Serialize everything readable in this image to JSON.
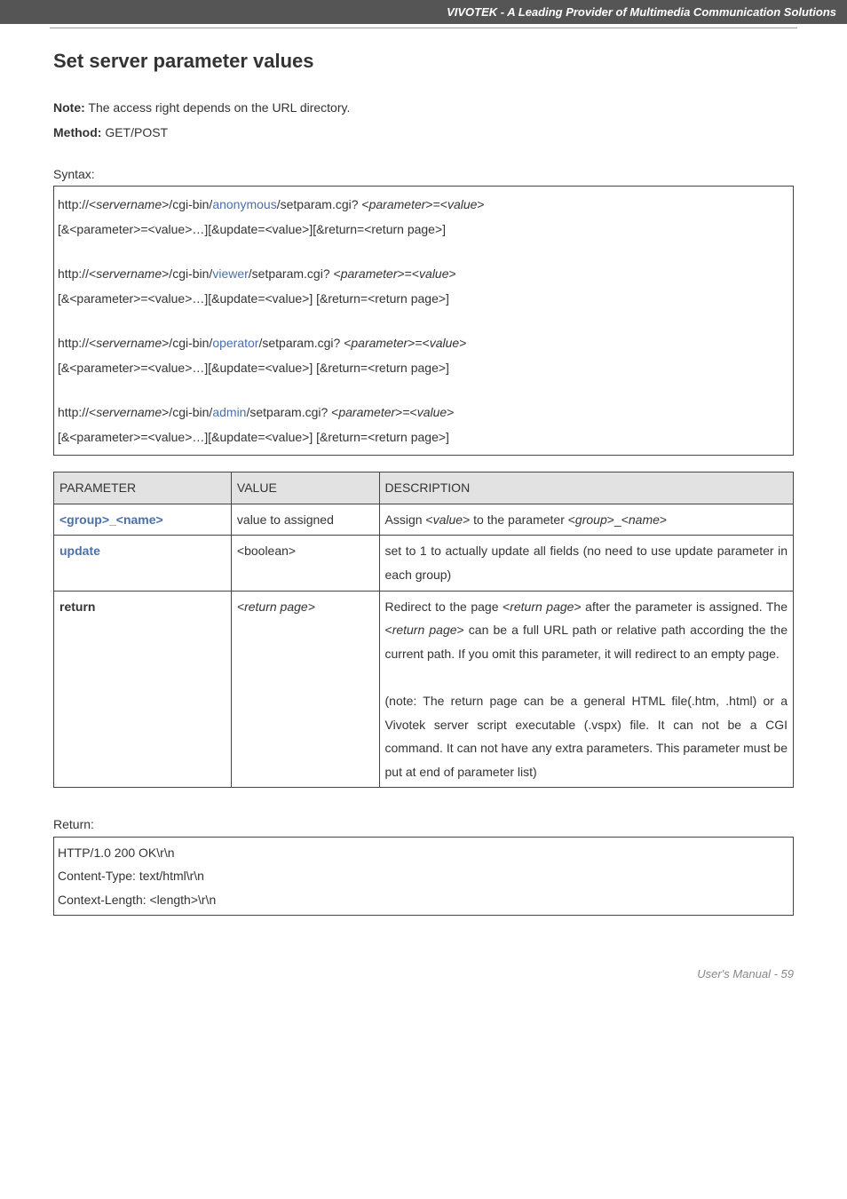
{
  "header": {
    "banner": "VIVOTEK - A Leading Provider of Multimedia Communication Solutions"
  },
  "title": "Set server parameter values",
  "intro": {
    "note_label": "Note:",
    "note_text": " The access right depends on the URL directory.",
    "method_label": "Method:",
    "method_text": " GET/POST"
  },
  "syntax_label": "Syntax:",
  "syntax": {
    "blocks": [
      {
        "pre": "http://<",
        "srv": "servername",
        "mid": ">/cgi-bin/",
        "role": "anonymous",
        "post": "/setparam.cgi? <",
        "param": "parameter",
        "eq": ">=<",
        "val": "value",
        "end": ">",
        "line2": "[&<parameter>=<value>…][&update=<value>][&return=<return page>]"
      },
      {
        "pre": "http://<",
        "srv": "servername",
        "mid": ">/cgi-bin/",
        "role": "viewer",
        "post": "/setparam.cgi? <",
        "param": "parameter",
        "eq": ">=<",
        "val": "value",
        "end": ">",
        "line2": "[&<parameter>=<value>…][&update=<value>] [&return=<return page>]"
      },
      {
        "pre": "http://<",
        "srv": "servername",
        "mid": ">/cgi-bin/",
        "role": "operator",
        "post": "/setparam.cgi? <",
        "param": "parameter",
        "eq": ">=<",
        "val": "value",
        "end": ">",
        "line2": "[&<parameter>=<value>…][&update=<value>] [&return=<return page>]"
      },
      {
        "pre": "http://<",
        "srv": "servername",
        "mid": ">/cgi-bin/",
        "role": "admin",
        "post": "/setparam.cgi? <",
        "param": "parameter",
        "eq": ">=<",
        "val": "value",
        "end": ">",
        "line2": "[&<parameter>=<value>…][&update=<value>] [&return=<return page>]"
      }
    ]
  },
  "table": {
    "headers": {
      "c1": "PARAMETER",
      "c2": "VALUE",
      "c3": "DESCRIPTION"
    },
    "row0": {
      "p": "<group>_<name>",
      "v": "value to assigned",
      "d_pre": "Assign <",
      "d_val": "value",
      "d_mid": "> to the parameter <",
      "d_grp": "group",
      "d_us": ">_<",
      "d_nm": "name",
      "d_end": ">"
    },
    "row1": {
      "p": "update",
      "v": "<boolean>",
      "d": "set to 1 to actually update all fields (no need to use update parameter in each group)"
    },
    "row2": {
      "p": "return",
      "v": "<return page>",
      "d1a": "Redirect to the page <",
      "d1b": "return page",
      "d1c": "> after the parameter is assigned. The <",
      "d1d": "return page",
      "d1e": "> can be a full URL path or relative path according the the current path. If you omit this parameter, it will redirect to an empty page.",
      "d2": "(note: The return page can be a general HTML file(.htm, .html) or a Vivotek server script executable (.vspx) file. It can not be a CGI command. It can not have any extra parameters. This parameter must be put at end of parameter list)"
    }
  },
  "return_label": "Return:",
  "return_box": {
    "l1": "HTTP/1.0 200 OK\\r\\n",
    "l2": "Content-Type: text/html\\r\\n",
    "l3": "Context-Length: <length>\\r\\n"
  },
  "footer": {
    "text": "User's Manual - 59"
  }
}
